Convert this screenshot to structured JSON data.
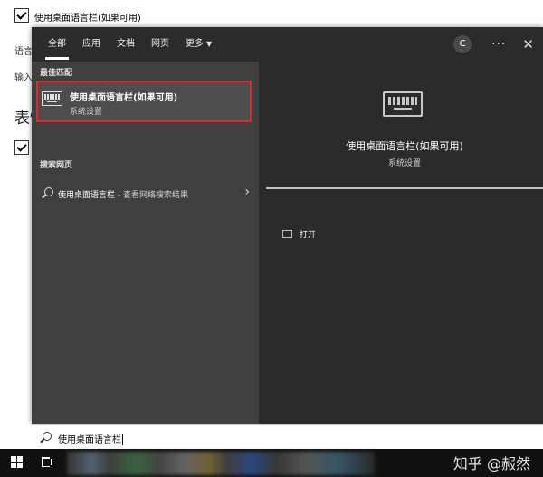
{
  "background_page": {
    "checkbox_label": "使用桌面语言栏(如果可用)",
    "line1": "语言",
    "line2": "输入",
    "heading": "表情"
  },
  "tabs": [
    {
      "label": "全部"
    },
    {
      "label": "应用"
    },
    {
      "label": "文档"
    },
    {
      "label": "网页"
    },
    {
      "label": "更多"
    }
  ],
  "top_right": {
    "avatar_letter": "C",
    "more_symbol": "···",
    "close_symbol": "✕"
  },
  "results": {
    "best_match_label": "最佳匹配",
    "best_match": {
      "title": "使用桌面语言栏(如果可用)",
      "subtitle": "系统设置",
      "icon": "keyboard-icon"
    },
    "web_label": "搜索网页",
    "web_item": {
      "query": "使用桌面语言栏",
      "suffix": " - 查看网络搜索结果"
    }
  },
  "preview": {
    "icon": "keyboard-icon",
    "title": "使用桌面语言栏(如果可用)",
    "subtitle": "系统设置",
    "open_label": "打开"
  },
  "search": {
    "value": "使用桌面语言栏"
  },
  "watermark": "知乎 @赧然",
  "colors": {
    "panel_bg": "#2b2b2b",
    "results_bg": "#3f3f3f",
    "highlight_border": "#e0252b",
    "taskbar_bg": "#101010"
  }
}
